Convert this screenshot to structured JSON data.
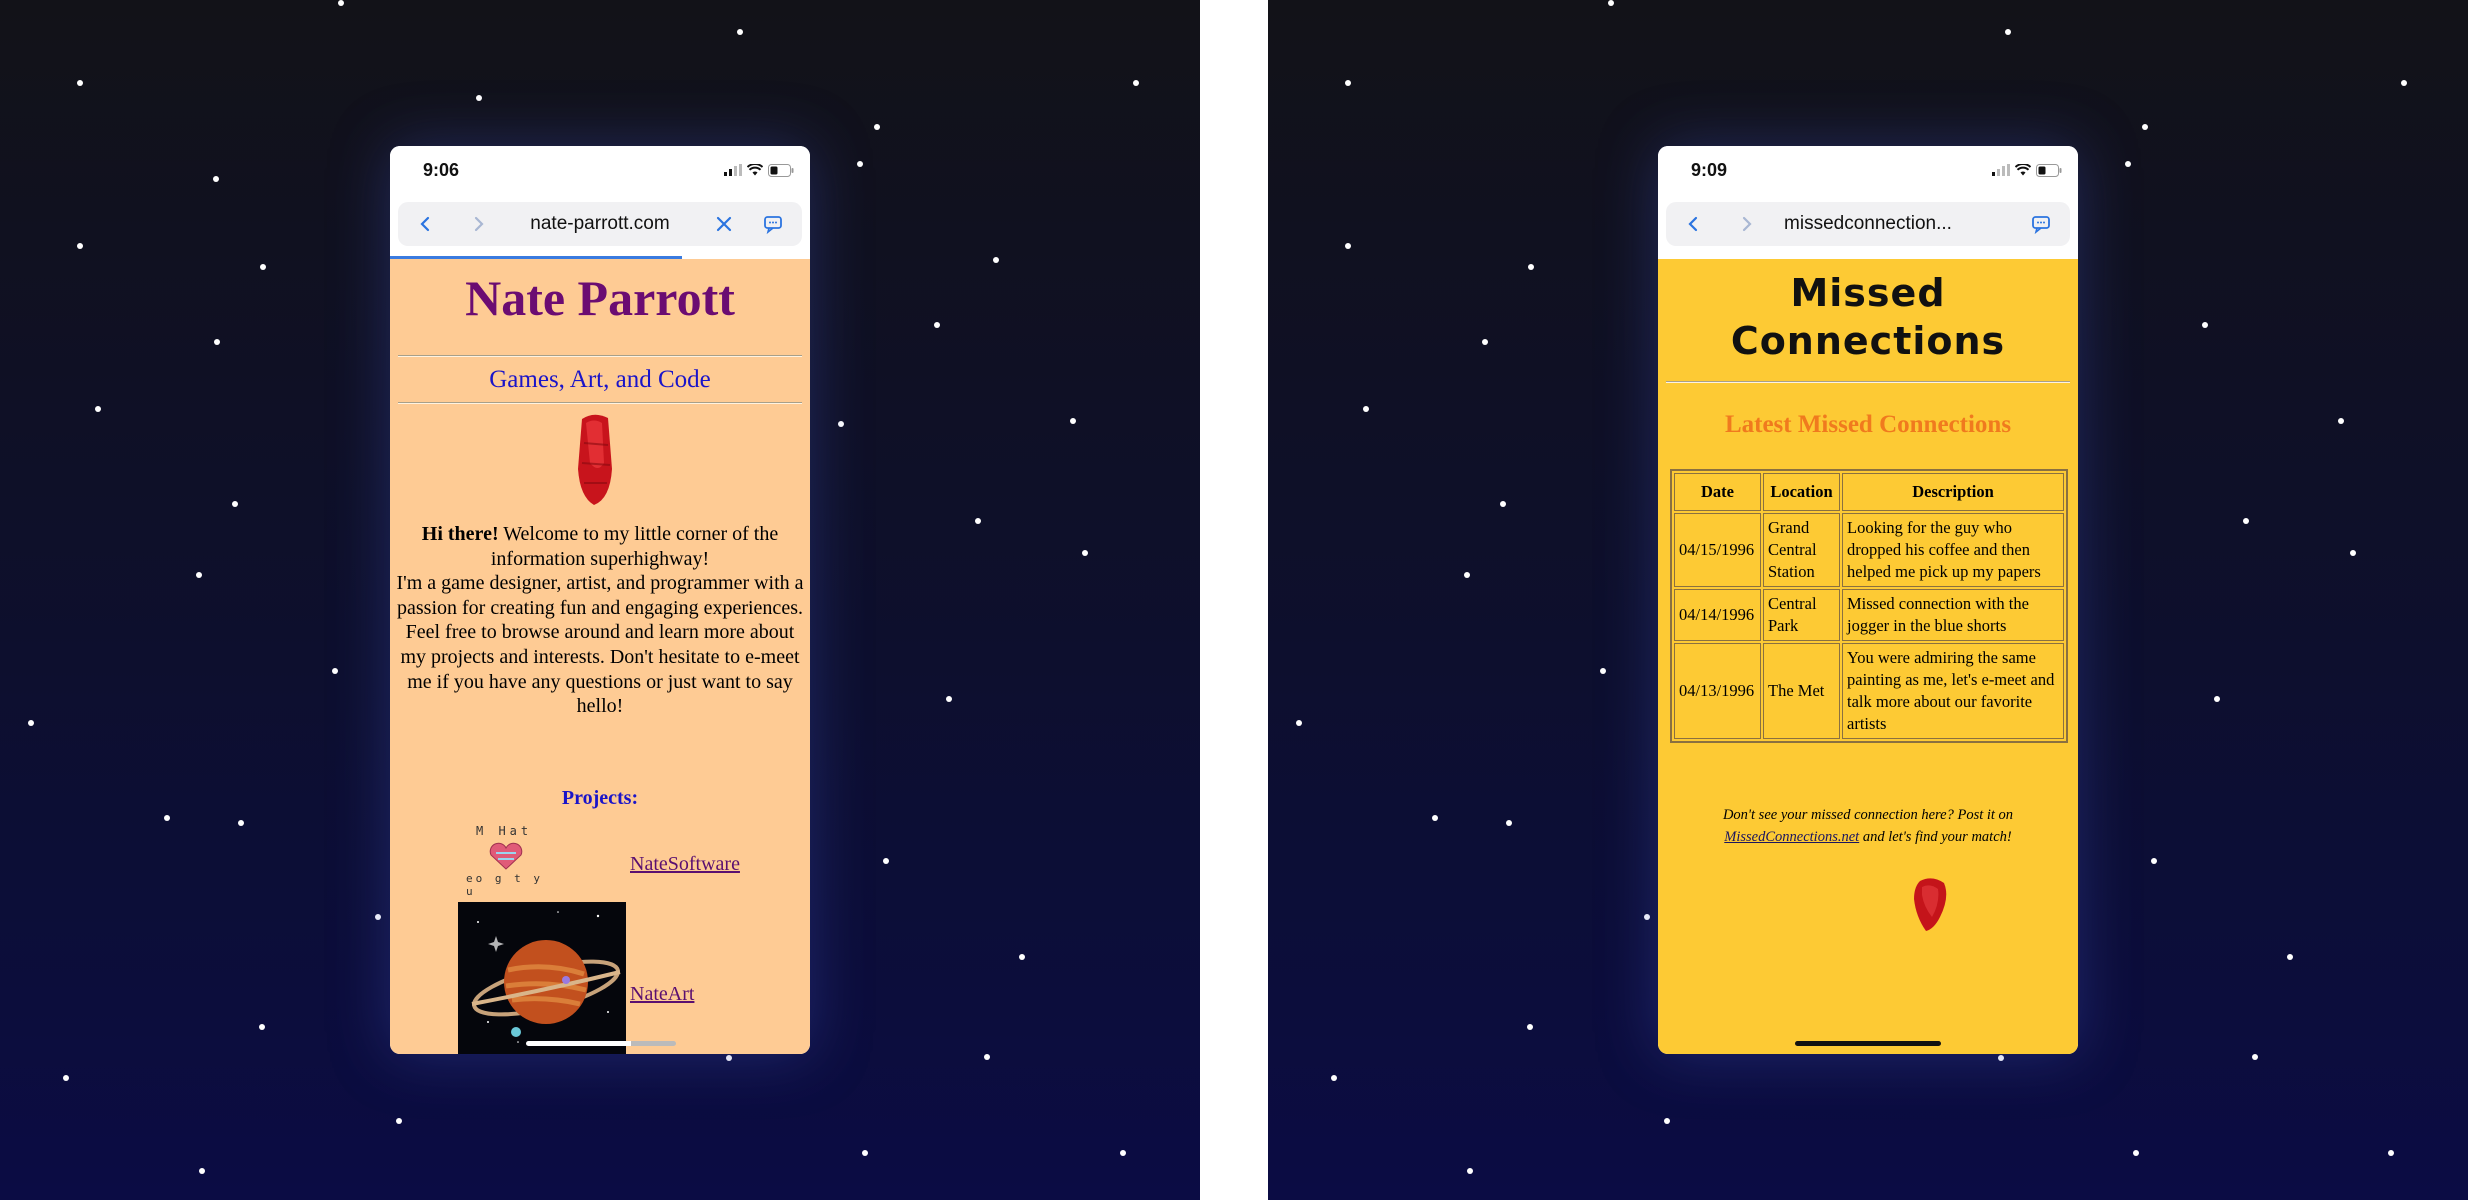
{
  "left_phone": {
    "status_time": "9:06",
    "url": "nate-parrott.com",
    "page": {
      "title": "Nate Parrott",
      "subtitle": "Games, Art, and Code",
      "intro_bold": "Hi there!",
      "intro_line1": " Welcome to my little corner of the information superhighway!",
      "intro_line2": "I'm a game designer, artist, and programmer with a passion for creating fun and engaging experiences.",
      "intro_line3": "Feel free to browse around and learn more about my projects and interests. Don't hesitate to e-meet me if you have any questions or just want to say hello!",
      "projects_heading": "Projects:",
      "projects": [
        {
          "label": "NateSoftware",
          "image_text": "M Hat / eo g t y u"
        },
        {
          "label": "NateArt"
        }
      ]
    }
  },
  "right_phone": {
    "status_time": "9:09",
    "url": "missedconnection...",
    "page": {
      "title_line1": "Missed",
      "title_line2": "Connections",
      "latest_heading": "Latest Missed Connections",
      "table": {
        "headers": [
          "Date",
          "Location",
          "Description"
        ],
        "rows": [
          [
            "04/15/1996",
            "Grand Central Station",
            "Looking for the guy who dropped his coffee and then helped me pick up my papers"
          ],
          [
            "04/14/1996",
            "Central Park",
            "Missed connection with the jogger in the blue shorts"
          ],
          [
            "04/13/1996",
            "The Met",
            "You were admiring the same painting as me, let's e-meet and talk more about our favorite artists"
          ]
        ]
      },
      "footer_pre": "Don't see your missed connection here? Post it on",
      "footer_link": "MissedConnections.net",
      "footer_post": " and let's find your match!"
    }
  },
  "colors": {
    "nate_bg": "#fecb94",
    "nate_title": "#6b0c72",
    "nate_blue": "#1a14c9",
    "missed_bg": "#fdca34",
    "missed_orange": "#f07a1e",
    "space_bg": "#0d0f2e"
  }
}
